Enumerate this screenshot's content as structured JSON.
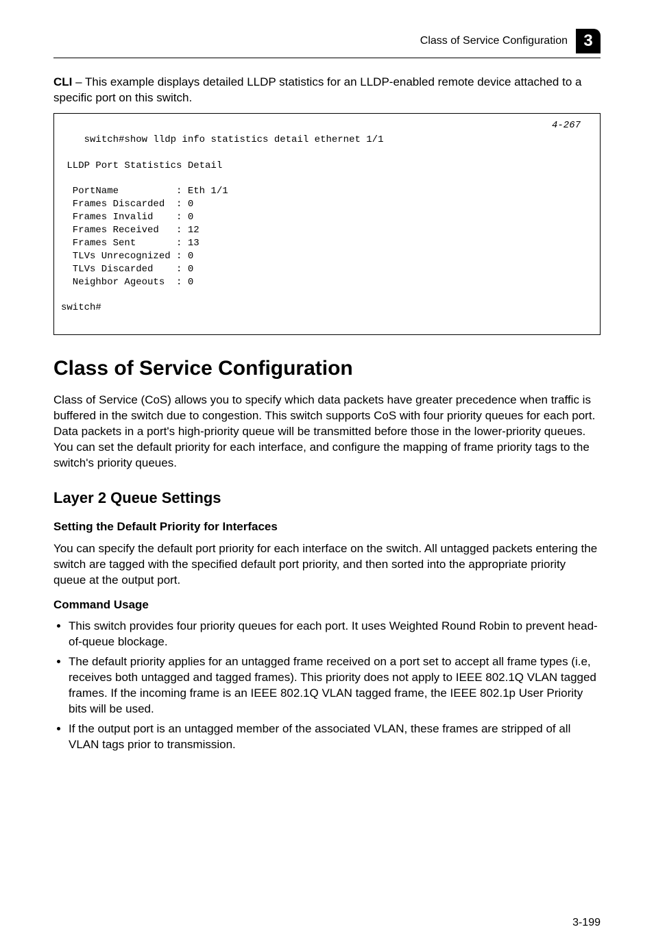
{
  "header": {
    "title": "Class of Service Configuration",
    "chapter_badge": "3"
  },
  "cli_intro": {
    "prefix": "CLI",
    "text": " – This example displays detailed LLDP statistics for an LLDP-enabled remote device attached to a specific port on this switch."
  },
  "code": {
    "ref": "4-267",
    "text": "switch#show lldp info statistics detail ethernet 1/1\n\n LLDP Port Statistics Detail\n\n  PortName          : Eth 1/1\n  Frames Discarded  : 0\n  Frames Invalid    : 0\n  Frames Received   : 12\n  Frames Sent       : 13\n  TLVs Unrecognized : 0\n  TLVs Discarded    : 0\n  Neighbor Ageouts  : 0\n\nswitch#"
  },
  "section_title": "Class of Service Configuration",
  "section_body": "Class of Service (CoS) allows you to specify which data packets have greater precedence when traffic is buffered in the switch due to congestion. This switch supports CoS with four priority queues for each port. Data packets in a port's high-priority queue will be transmitted before those in the lower-priority queues. You can set the default priority for each interface, and configure the mapping of frame priority tags to the switch's priority queues.",
  "subsection_title": "Layer 2 Queue Settings",
  "subsub_title": "Setting the Default Priority for Interfaces",
  "subsub_body": "You can specify the default port priority for each interface on the switch. All untagged packets entering the switch are tagged with the specified default port priority, and then sorted into the appropriate priority queue at the output port.",
  "command_usage_label": "Command Usage",
  "bullets": [
    "This switch provides four priority queues for each port. It uses Weighted Round Robin to prevent head-of-queue blockage.",
    "The default priority applies for an untagged frame received on a port set to accept all frame types (i.e, receives both untagged and tagged frames). This priority does not apply to IEEE 802.1Q VLAN tagged frames. If the incoming frame is an IEEE 802.1Q VLAN tagged frame, the IEEE 802.1p User Priority bits will be used.",
    "If the output port is an untagged member of the associated VLAN, these frames are stripped of all VLAN tags prior to transmission."
  ],
  "page_number": "3-199"
}
